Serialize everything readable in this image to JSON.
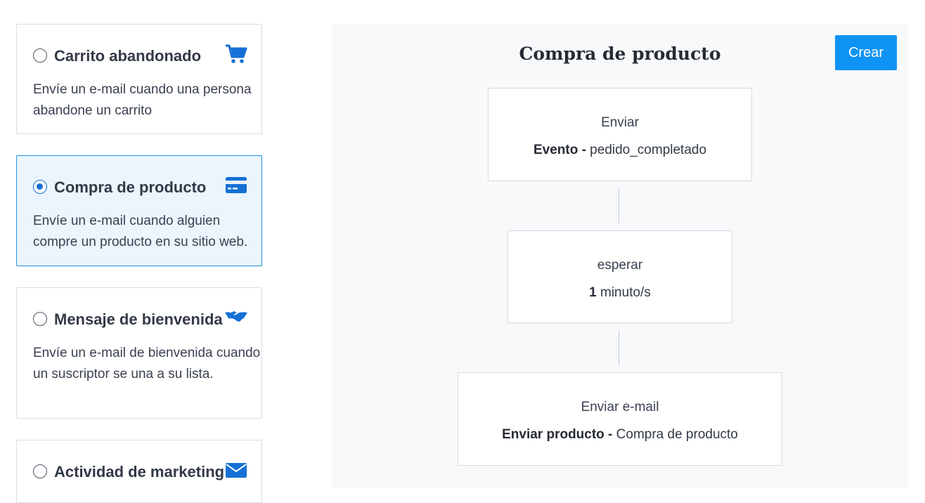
{
  "templates": [
    {
      "title": "Carrito abandonado",
      "description": "Envíe un e-mail cuando una persona abandone un carrito",
      "icon": "cart-icon",
      "selected": false
    },
    {
      "title": "Compra de producto",
      "description": "Envíe un e-mail cuando alguien compre un producto en su sitio web.",
      "icon": "credit-card-icon",
      "selected": true
    },
    {
      "title": "Mensaje de bienvenida",
      "description": "Envíe un e-mail de bienvenida cuando un suscriptor se una a su lista.",
      "icon": "handshake-icon",
      "selected": false
    },
    {
      "title": "Actividad de marketing",
      "description": "",
      "icon": "envelope-icon",
      "selected": false
    }
  ],
  "flow": {
    "title": "Compra de producto",
    "create_label": "Crear",
    "steps": [
      {
        "type": "Enviar",
        "detail_bold": "Evento -",
        "detail_text": " pedido_completado"
      },
      {
        "type": "esperar",
        "detail_bold": "1",
        "detail_text": " minuto/s"
      },
      {
        "type": "Enviar e-mail",
        "detail_bold": "Enviar producto -",
        "detail_text": " Compra de producto"
      }
    ]
  },
  "colors": {
    "accent": "#0f94f5",
    "icon": "#1570d6",
    "selected_bg": "#eaf5fe",
    "panel_bg": "#f8f9fb"
  }
}
